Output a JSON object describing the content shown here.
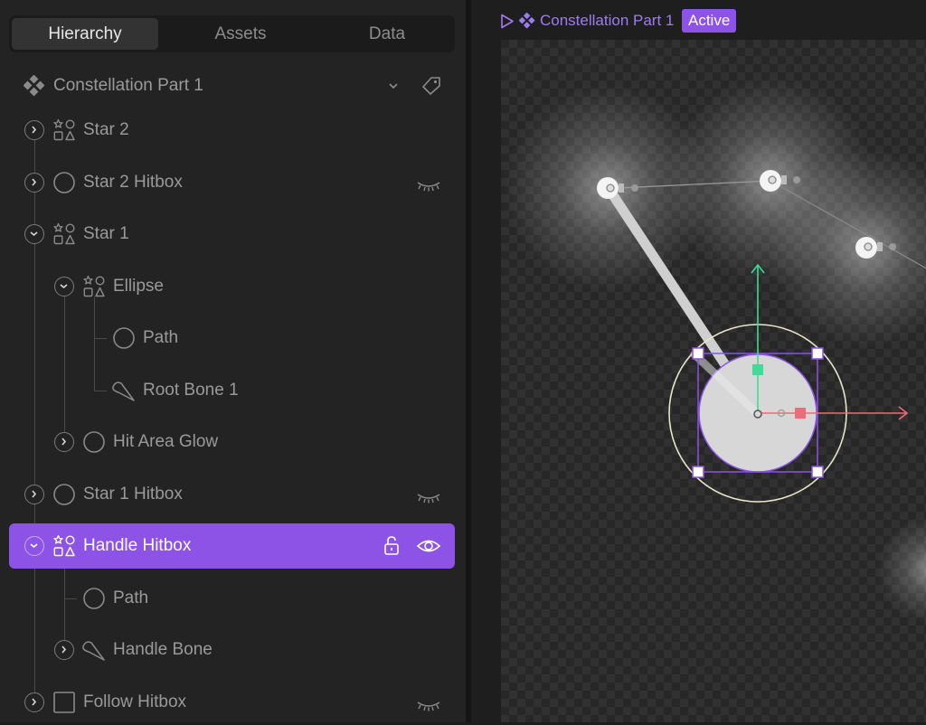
{
  "tabs": [
    "Hierarchy",
    "Assets",
    "Data"
  ],
  "artboard": {
    "name": "Constellation Part 1"
  },
  "tree": [
    {
      "label": "Star 2"
    },
    {
      "label": "Star 2 Hitbox"
    },
    {
      "label": "Star 1"
    },
    {
      "label": "Ellipse"
    },
    {
      "label": "Path"
    },
    {
      "label": "Root Bone 1"
    },
    {
      "label": "Hit Area Glow"
    },
    {
      "label": "Star 1 Hitbox"
    },
    {
      "label": "Handle Hitbox"
    },
    {
      "label": "Path"
    },
    {
      "label": "Handle Bone"
    },
    {
      "label": "Follow Hitbox"
    }
  ],
  "breadcrumb": {
    "name": "Constellation Part 1",
    "state": "Active"
  },
  "colors": {
    "accent": "#8c53e6",
    "crumb_text": "#9f7bf2",
    "y_axis": "#3ddc97",
    "x_axis": "#f06b7a"
  }
}
